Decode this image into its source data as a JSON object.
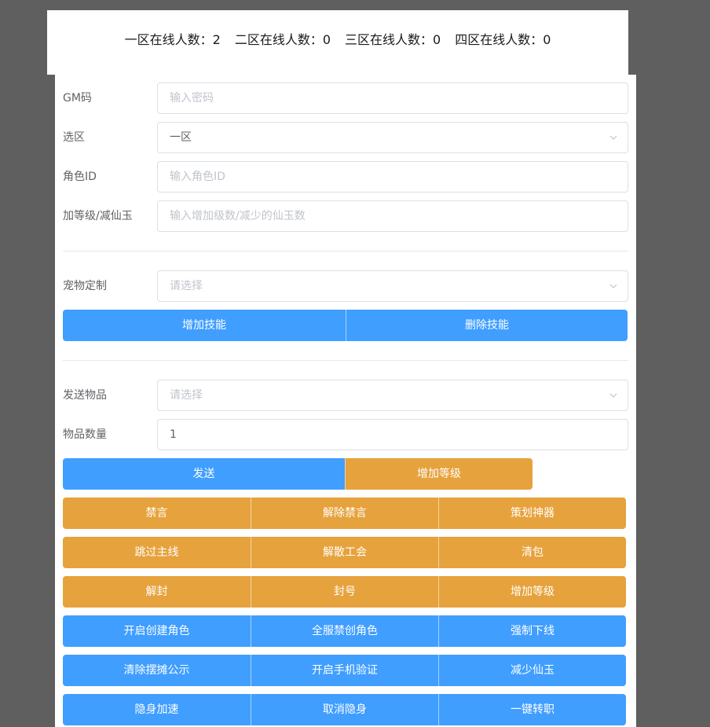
{
  "online": {
    "zone1": "一区在线人数：2",
    "zone2": "二区在线人数：0",
    "zone3": "三区在线人数：0",
    "zone4": "四区在线人数：0"
  },
  "form": {
    "gm_code": {
      "label": "GM码",
      "placeholder": "输入密码",
      "value": ""
    },
    "zone": {
      "label": "选区",
      "value": "一区"
    },
    "role_id": {
      "label": "角色ID",
      "placeholder": "输入角色ID",
      "value": ""
    },
    "level_jade": {
      "label": "加等级/减仙玉",
      "placeholder": "输入增加级数/减少的仙玉数",
      "value": ""
    },
    "pet": {
      "label": "宠物定制",
      "placeholder": "请选择"
    },
    "send_item": {
      "label": "发送物品",
      "placeholder": "请选择"
    },
    "item_qty": {
      "label": "物品数量",
      "value": "1"
    }
  },
  "buttons": {
    "add_skill": "增加技能",
    "remove_skill": "删除技能",
    "send": "发送",
    "add_level_1": "增加等级",
    "mute": "禁言",
    "unmute": "解除禁言",
    "planner_artifact": "策划神器",
    "skip_main_quest": "跳过主线",
    "disband_guild": "解散工会",
    "clear_bag": "清包",
    "unban": "解封",
    "ban": "封号",
    "add_level_2": "增加等级",
    "enable_create_role": "开启创建角色",
    "disable_create_role_all": "全服禁创角色",
    "force_offline": "强制下线",
    "clear_stall_notice": "清除摆摊公示",
    "enable_phone_verify": "开启手机验证",
    "reduce_jade": "减少仙玉",
    "stealth_speed": "隐身加速",
    "cancel_stealth": "取消隐身",
    "one_click_job_change": "一键转职"
  },
  "colors": {
    "primary": "#409eff",
    "warning": "#e6a23c"
  }
}
